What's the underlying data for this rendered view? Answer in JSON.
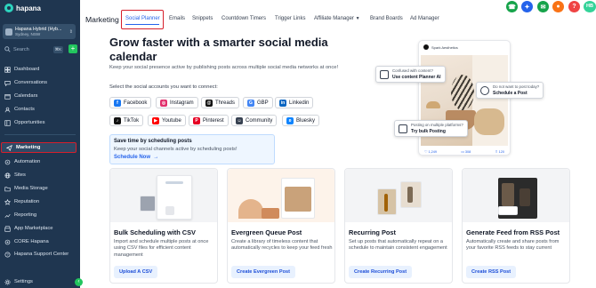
{
  "app": {
    "logo_text": "hapana"
  },
  "sidebar": {
    "account": {
      "name": "Hapana Hybrid (Hyb...",
      "location": "Sydney, NSW"
    },
    "search": {
      "placeholder": "Search",
      "shortcut": "⌘K"
    },
    "items": [
      {
        "label": "Dashboard",
        "icon": "dashboard-icon"
      },
      {
        "label": "Conversations",
        "icon": "chat-icon"
      },
      {
        "label": "Calendars",
        "icon": "calendar-icon"
      },
      {
        "label": "Contacts",
        "icon": "contacts-icon"
      },
      {
        "label": "Opportunities",
        "icon": "opportunities-icon"
      },
      {
        "label": "Marketing",
        "icon": "send-icon",
        "active": true
      },
      {
        "label": "Automation",
        "icon": "automation-icon"
      },
      {
        "label": "Sites",
        "icon": "globe-icon"
      },
      {
        "label": "Media Storage",
        "icon": "folder-icon"
      },
      {
        "label": "Reputation",
        "icon": "star-icon"
      },
      {
        "label": "Reporting",
        "icon": "chart-icon"
      },
      {
        "label": "App Marketplace",
        "icon": "store-icon"
      },
      {
        "label": "CORE Hapana",
        "icon": "core-icon"
      },
      {
        "label": "Hapana Support Center",
        "icon": "help-icon"
      },
      {
        "label": "Settings",
        "icon": "gear-icon"
      }
    ]
  },
  "topbar": {
    "section_title": "Marketing",
    "tabs": [
      "Social Planner",
      "Emails",
      "Snippets",
      "Countdown Timers",
      "Trigger Links",
      "Affiliate Manager",
      "Brand Boards",
      "Ad Manager"
    ],
    "active_tab": "Social Planner",
    "icon_colors": [
      "#16a34a",
      "#2563eb",
      "#16a34a",
      "#f97316",
      "#ef4444",
      "#2563eb"
    ],
    "avatar_initials": "HB"
  },
  "hero": {
    "title": "Grow faster with a smarter social media calendar",
    "description": "Keep your social presence active by publishing posts across multiple social media networks at once!",
    "select_label": "Select the social accounts you want to connect:",
    "accounts": [
      {
        "label": "Facebook",
        "icon": "facebook-icon",
        "color": "#1877f2"
      },
      {
        "label": "Instagram",
        "icon": "instagram-icon",
        "color": "#e1306c"
      },
      {
        "label": "Threads",
        "icon": "threads-icon",
        "color": "#111111"
      },
      {
        "label": "GBP",
        "icon": "gbp-icon",
        "color": "#4285f4"
      },
      {
        "label": "Linkedin",
        "icon": "linkedin-icon",
        "color": "#0a66c2"
      },
      {
        "label": "TikTok",
        "icon": "tiktok-icon",
        "color": "#111111"
      },
      {
        "label": "Youtube",
        "icon": "youtube-icon",
        "color": "#ff0000"
      },
      {
        "label": "Pinterest",
        "icon": "pinterest-icon",
        "color": "#e60023"
      },
      {
        "label": "Community",
        "icon": "community-icon",
        "color": "#374151"
      },
      {
        "label": "Bluesky",
        "icon": "bluesky-icon",
        "color": "#1185fe"
      }
    ],
    "tip": {
      "title": "Save time by scheduling posts",
      "description": "Keep your social channels active by scheduling posts!",
      "link": "Schedule Now"
    }
  },
  "mockup": {
    "profile_name": "Spark Aesthetics",
    "stats": [
      "1,249",
      "308",
      "120"
    ],
    "bubbles": [
      {
        "question": "Confused with content?",
        "answer": "Use content Planner AI"
      },
      {
        "question": "Do not want to post today?",
        "answer": "Schedule a Post"
      },
      {
        "question": "Posting on multiple platforms?",
        "answer": "Try bulk Posting"
      }
    ]
  },
  "cards": [
    {
      "title": "Bulk Scheduling with CSV",
      "description": "Import and schedule multiple posts at once using CSV files for efficient content management",
      "button": "Upload A CSV"
    },
    {
      "title": "Evergreen Queue Post",
      "description": "Create a library of timeless content that automatically recycles to keep your feed fresh",
      "button": "Create Evergreen Post"
    },
    {
      "title": "Recurring Post",
      "description": "Set up posts that automatically repeat on a schedule to maintain consistent engagement",
      "button": "Create Recurring Post"
    },
    {
      "title": "Generate Feed from RSS Post",
      "description": "Automatically create and share posts from your favorite RSS feeds to stay current",
      "button": "Create RSS Post"
    }
  ]
}
